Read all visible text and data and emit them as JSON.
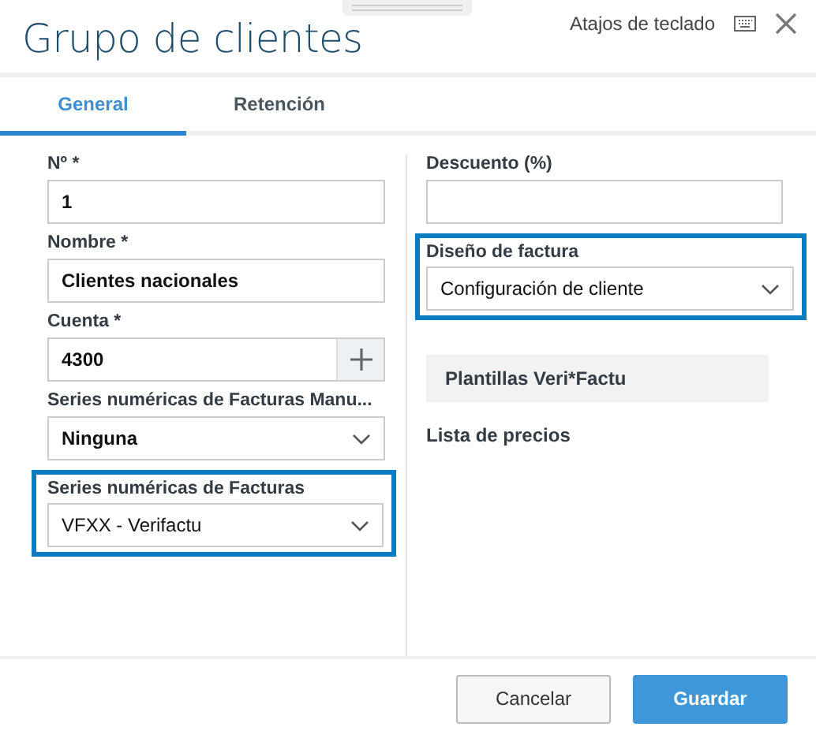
{
  "window": {
    "title": "Grupo de clientes",
    "shortcuts_label": "Atajos de teclado"
  },
  "tabs": [
    {
      "label": "General",
      "selected": true
    },
    {
      "label": "Retención",
      "selected": false
    }
  ],
  "left_fields": [
    {
      "kind": "text",
      "label": "Nº *",
      "value": "1",
      "highlighted": false
    },
    {
      "kind": "text",
      "label": "Nombre *",
      "value": "Clientes nacionales",
      "highlighted": false
    },
    {
      "kind": "add",
      "label": "Cuenta *",
      "value": "4300",
      "highlighted": false
    },
    {
      "kind": "select",
      "label": "Series numéricas de Facturas Manu...",
      "value": "Ninguna",
      "highlighted": false
    },
    {
      "kind": "select",
      "label": "Series numéricas de Facturas",
      "value": "VFXX - Verifactu",
      "highlighted": true
    }
  ],
  "right_fields": [
    {
      "kind": "text",
      "label": "Descuento (%)",
      "highlighted": false
    },
    {
      "kind": "select",
      "label": "Diseño de factura",
      "value": "Configuración de cliente",
      "highlighted": true
    },
    {
      "kind": "button",
      "label": "Plantillas Veri*Factu"
    },
    {
      "kind": "heading",
      "label": "Lista de precios"
    }
  ],
  "buttons": [
    {
      "label": "Cancelar",
      "kind": "secondary"
    },
    {
      "label": "Guardar",
      "kind": "primary"
    }
  ]
}
